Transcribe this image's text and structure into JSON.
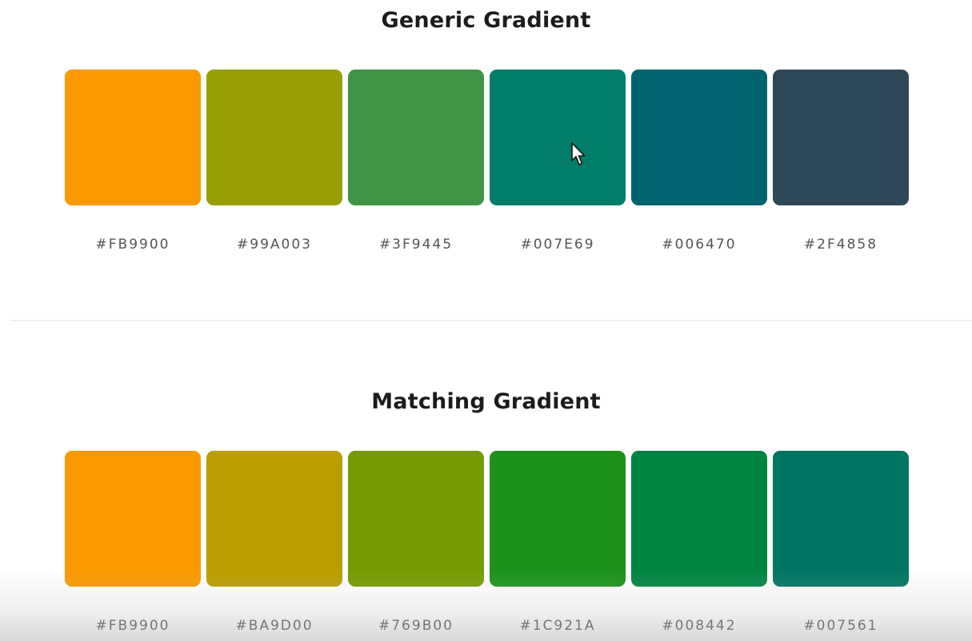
{
  "generic": {
    "title": "Generic Gradient",
    "swatches": [
      {
        "hex": "#FB9900",
        "color": "#FB9900"
      },
      {
        "hex": "#99A003",
        "color": "#99A003"
      },
      {
        "hex": "#3F9445",
        "color": "#3F9445"
      },
      {
        "hex": "#007E69",
        "color": "#007E69"
      },
      {
        "hex": "#006470",
        "color": "#006470"
      },
      {
        "hex": "#2F4858",
        "color": "#2F4858"
      }
    ]
  },
  "matching": {
    "title": "Matching Gradient",
    "swatches": [
      {
        "hex": "#FB9900",
        "color": "#FB9900"
      },
      {
        "hex": "#BA9D00",
        "color": "#BA9D00"
      },
      {
        "hex": "#769B00",
        "color": "#769B00"
      },
      {
        "hex": "#1C921A",
        "color": "#1C921A"
      },
      {
        "hex": "#008442",
        "color": "#008442"
      },
      {
        "hex": "#007561",
        "color": "#007561"
      }
    ]
  },
  "theme": {
    "background": "#FFFFFF",
    "title_color": "#1C1C1C",
    "hex_label_color": "#555555",
    "divider_color": "#EFEFEF"
  },
  "cursor": {
    "icon": "arrow-pointer-icon"
  }
}
